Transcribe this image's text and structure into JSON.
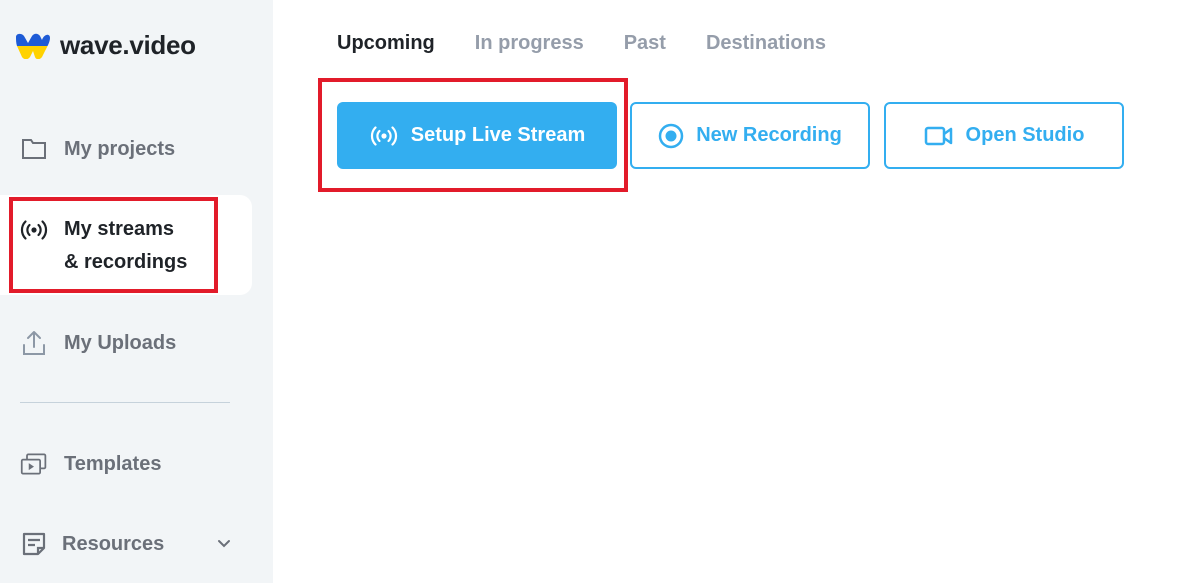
{
  "brand": {
    "name": "wave.video",
    "logo_colors": {
      "top": "#1e5bd6",
      "bottom": "#ffd200"
    }
  },
  "sidebar": {
    "items": [
      {
        "label": "My projects",
        "icon": "folder-icon",
        "active": false
      },
      {
        "label_line1": "My streams",
        "label_line2": "& recordings",
        "icon": "broadcast-icon",
        "active": true
      },
      {
        "label": "My Uploads",
        "icon": "upload-icon",
        "active": false
      },
      {
        "label": "Templates",
        "icon": "templates-icon",
        "active": false
      },
      {
        "label": "Resources",
        "icon": "resources-icon",
        "active": false,
        "expandable": true
      }
    ]
  },
  "tabs": [
    {
      "label": "Upcoming",
      "active": true
    },
    {
      "label": "In progress",
      "active": false
    },
    {
      "label": "Past",
      "active": false
    },
    {
      "label": "Destinations",
      "active": false
    }
  ],
  "actions": {
    "setup_live_stream": {
      "label": "Setup Live Stream",
      "icon": "broadcast-icon"
    },
    "new_recording": {
      "label": "New Recording",
      "icon": "record-icon"
    },
    "open_studio": {
      "label": "Open Studio",
      "icon": "video-camera-icon"
    }
  },
  "colors": {
    "accent": "#33aef0",
    "sidebar_bg": "#f2f5f7",
    "annotation": "#e21b2a"
  }
}
